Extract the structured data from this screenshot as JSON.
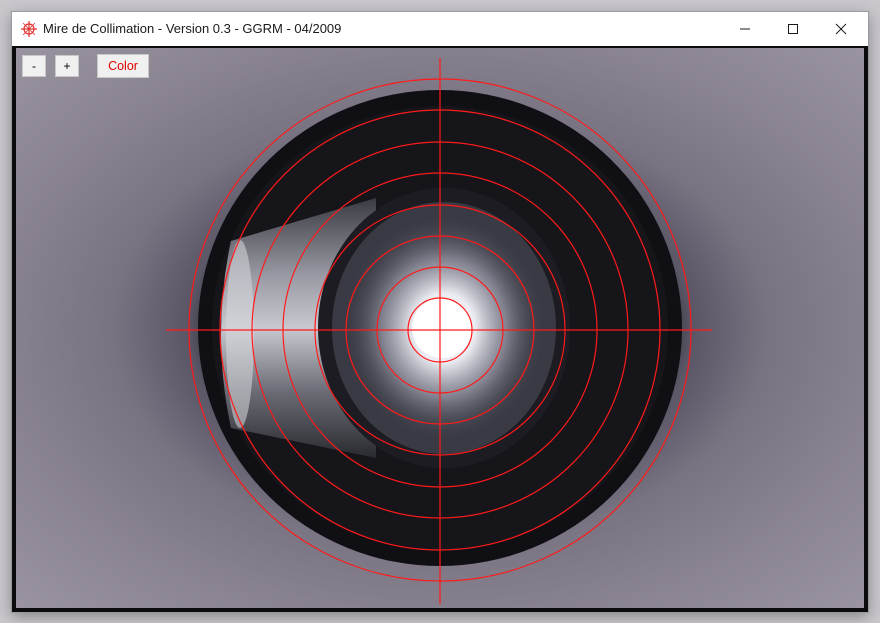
{
  "window": {
    "title": "Mire de Collimation - Version 0.3 - GGRM - 04/2009",
    "app_icon": "collimation-crosshair-icon",
    "controls": {
      "minimize_icon": "minimize-icon",
      "maximize_icon": "maximize-icon",
      "close_icon": "close-icon"
    }
  },
  "toolbar": {
    "zoom_out_label": "-",
    "zoom_in_label": "+",
    "color_label": "Color"
  },
  "overlay": {
    "reticle_color": "#ff1a1a",
    "ring_count": 8,
    "crosshair": true
  },
  "colors": {
    "reticle": "#ff1a1a",
    "color_button_text": "#e00000"
  }
}
